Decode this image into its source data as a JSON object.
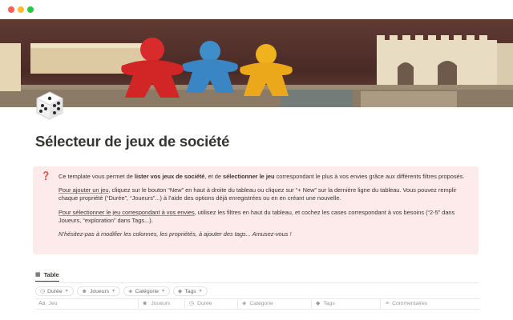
{
  "window": {
    "controls": [
      "close",
      "minimize",
      "maximize"
    ]
  },
  "page": {
    "icon": "dice-icon",
    "title": "Sélecteur de jeux de société"
  },
  "callout": {
    "icon": "question-mark-icon",
    "color": "#fdebec",
    "p1_a": "Ce template vous permet de ",
    "p1_b": "lister vos jeux de société",
    "p1_c": ", et de ",
    "p1_d": "sélectionner le jeu",
    "p1_e": " correspondant le plus à vos envies grâce aux différents filtres proposés.",
    "p2_a": "Pour ajouter un jeu",
    "p2_b": ", cliquez sur le bouton “New” en haut à droite du tableau ou cliquez sur “+ New” sur la dernière ligne du tableau. Vous pouvez remplir chaque propriété (“Durée”, “Joueurs”...) à l’aide des options déjà enregistrées ou en en créant une nouvelle.",
    "p3_a": "Pour sélectionner le jeu correspondant à vos envies",
    "p3_b": ", utilisez les filtres en haut du tableau, et cochez les cases correspondant à vos besoins (“2-5” dans Joueurs, “exploration” dans Tags...).",
    "p4": "N’hésitez-pas à modifier les colonnes, les propriétés, à ajouter des tags... Amusez-vous !"
  },
  "views": {
    "active_tab": "Table"
  },
  "filters": [
    {
      "label": "Durée",
      "icon": "clock-icon"
    },
    {
      "label": "Joueurs",
      "icon": "people-icon"
    },
    {
      "label": "Catégorie",
      "icon": "shapes-icon"
    },
    {
      "label": "Tags",
      "icon": "tag-icon"
    }
  ],
  "columns": [
    {
      "label": "Jeu",
      "icon": "text-icon"
    },
    {
      "label": "Joueurs",
      "icon": "people-icon"
    },
    {
      "label": "Durée",
      "icon": "clock-icon"
    },
    {
      "label": "Catégorie",
      "icon": "shapes-icon"
    },
    {
      "label": "Tags",
      "icon": "tag-icon"
    },
    {
      "label": "Commentaires",
      "icon": "lines-icon"
    }
  ]
}
